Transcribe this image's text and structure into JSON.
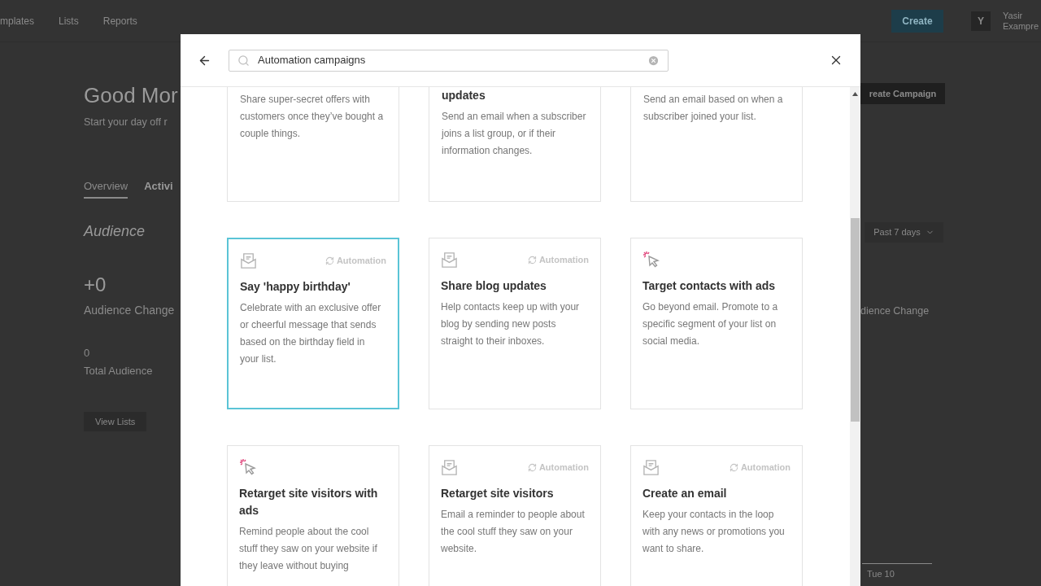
{
  "background_page": {
    "nav": [
      "mplates",
      "Lists",
      "Reports"
    ],
    "create_button": "Create",
    "avatar": "Y",
    "user_name": "Yasir",
    "user_org": "Exampre",
    "greeting": "Good Mor",
    "subtitle": "Start your day off r",
    "tabs": [
      {
        "label": "Overview",
        "selected": true
      },
      {
        "label": "Activi",
        "selected": false
      }
    ],
    "section_title": "Audience",
    "audience_change_value": "+0",
    "audience_change_label": "Audience Change",
    "total_value": "0",
    "total_label": "Total Audience",
    "view_lists_button": "View Lists",
    "create_campaign_button": "reate Campaign",
    "range_dropdown": "Past 7 days",
    "right_change_label": "dience Change",
    "chart_day": "Tue 10"
  },
  "modal": {
    "search": {
      "value": "Automation campaigns"
    },
    "cards": [
      {
        "description": "Share super-secret offers with customers once they’ve bought a couple things.",
        "selected": false
      },
      {
        "title": "updates",
        "description": "Send an email when a subscriber joins a list group, or if their information changes.",
        "selected": false
      },
      {
        "description": "Send an email based on when a subscriber joined your list.",
        "selected": false
      },
      {
        "kind": "email",
        "tag": "Automation",
        "title": "Say 'happy birthday'",
        "description": "Celebrate with an exclusive offer or cheerful message that sends based on the birthday field in your list.",
        "selected": true
      },
      {
        "kind": "email",
        "tag": "Automation",
        "title": "Share blog updates",
        "description": "Help contacts keep up with your blog by sending new posts straight to their inboxes.",
        "selected": false
      },
      {
        "kind": "ads",
        "title": "Target contacts with ads",
        "description": "Go beyond email. Promote to a specific segment of your list on social media.",
        "selected": false
      },
      {
        "kind": "ads",
        "title": "Retarget site visitors with ads",
        "description": "Remind people about the cool stuff they saw on your website if they leave without buying",
        "selected": false
      },
      {
        "kind": "email",
        "tag": "Automation",
        "title": "Retarget site visitors",
        "description": "Email a reminder to people about the cool stuff they saw on your website.",
        "selected": false
      },
      {
        "kind": "email",
        "tag": "Automation",
        "title": "Create an email",
        "description": "Keep your contacts in the loop with any news or promotions you want to share.",
        "selected": false
      }
    ]
  }
}
